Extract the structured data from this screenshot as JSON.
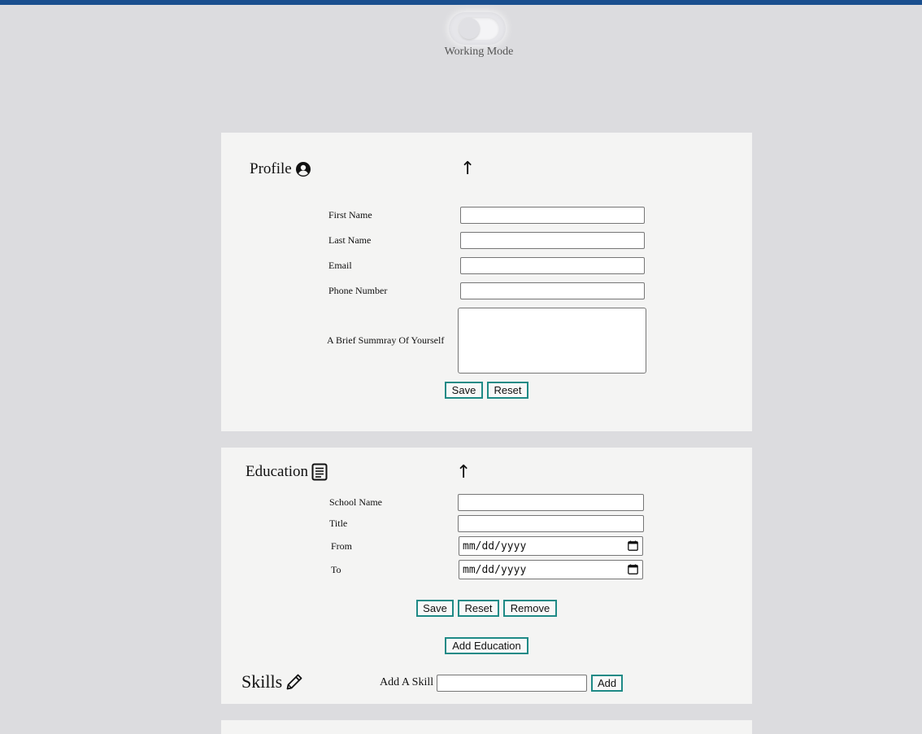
{
  "toggle": {
    "label": "Working Mode",
    "on": false
  },
  "profile": {
    "title": "Profile",
    "icon": "user-circle-icon",
    "collapse_icon": "↑",
    "fields": {
      "first_name": {
        "label": "First Name",
        "value": ""
      },
      "last_name": {
        "label": "Last Name",
        "value": ""
      },
      "email": {
        "label": "Email",
        "value": ""
      },
      "phone": {
        "label": "Phone Number",
        "value": ""
      },
      "summary": {
        "label": "A Brief Summray Of Yourself",
        "value": ""
      }
    },
    "save_label": "Save",
    "reset_label": "Reset"
  },
  "education": {
    "title": "Education",
    "icon": "document-icon",
    "collapse_icon": "↑",
    "fields": {
      "school": {
        "label": "School Name",
        "value": ""
      },
      "title": {
        "label": "Title",
        "value": ""
      },
      "from": {
        "label": "From",
        "placeholder": "mm/dd/yyyy"
      },
      "to": {
        "label": "To",
        "placeholder": "mm/dd/yyyy"
      }
    },
    "save_label": "Save",
    "reset_label": "Reset",
    "remove_label": "Remove",
    "add_label": "Add Education"
  },
  "skills": {
    "title": "Skills",
    "icon": "pencil-icon",
    "add_label": "Add A Skill",
    "input_value": "",
    "add_button": "Add"
  },
  "colors": {
    "accent": "#1f8a86",
    "topbar": "#1a4f8f",
    "card": "#f4f4f3",
    "background": "#dcdcdf"
  }
}
